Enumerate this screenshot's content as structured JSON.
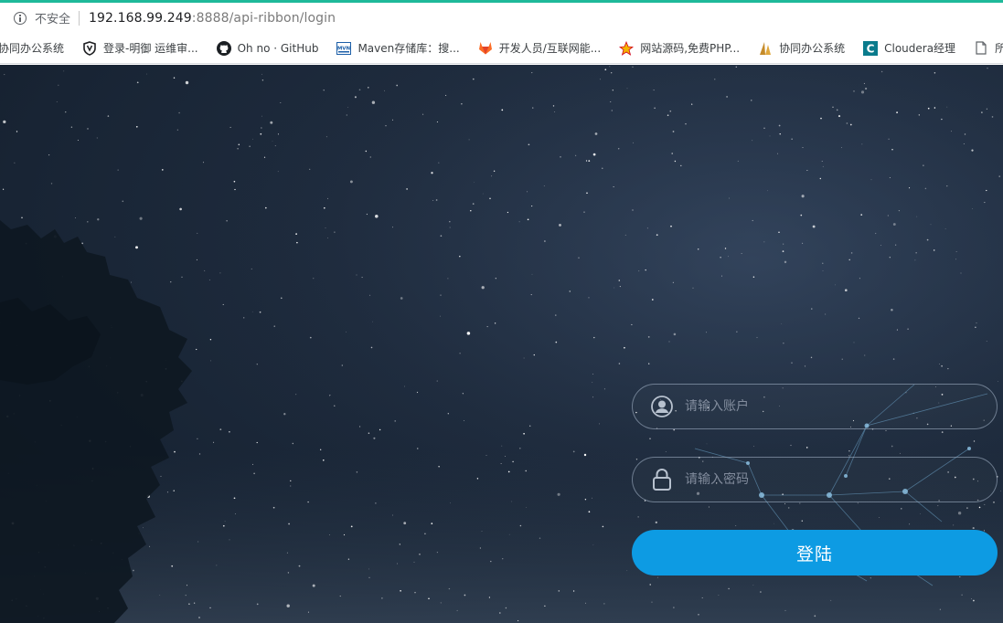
{
  "browser": {
    "insecure_label": "不安全",
    "url_host": "192.168.99.249",
    "url_rest": ":8888/api-ribbon/login",
    "accent_color": "#1fb99a"
  },
  "bookmarks": [
    {
      "label": "协同办公系统",
      "icon": "doc-icon"
    },
    {
      "label": "登录-明御 运维审...",
      "icon": "shield-icon"
    },
    {
      "label": "Oh no · GitHub",
      "icon": "github-icon"
    },
    {
      "label": "Maven存储库：搜...",
      "icon": "maven-icon"
    },
    {
      "label": "开发人员/互联网能...",
      "icon": "gitlab-icon"
    },
    {
      "label": "网站源码,免费PHP...",
      "icon": "star-icon"
    },
    {
      "label": "协同办公系统",
      "icon": "sail-icon"
    },
    {
      "label": "Cloudera经理",
      "icon": "cloudera-icon"
    },
    {
      "label": "所有",
      "icon": "file-icon"
    }
  ],
  "login": {
    "username_placeholder": "请输入账户",
    "password_placeholder": "请输入密码",
    "submit_label": "登陆",
    "button_color": "#0d9be3"
  }
}
